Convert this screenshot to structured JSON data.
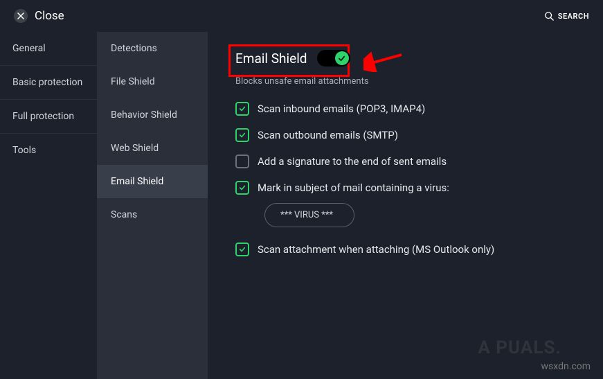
{
  "header": {
    "close_label": "Close",
    "search_label": "SEARCH"
  },
  "sidebar_primary": {
    "items": [
      {
        "label": "General"
      },
      {
        "label": "Basic protection"
      },
      {
        "label": "Full protection"
      },
      {
        "label": "Tools"
      }
    ]
  },
  "sidebar_secondary": {
    "items": [
      {
        "label": "Detections"
      },
      {
        "label": "File Shield"
      },
      {
        "label": "Behavior Shield"
      },
      {
        "label": "Web Shield"
      },
      {
        "label": "Email Shield",
        "active": true
      },
      {
        "label": "Scans"
      }
    ]
  },
  "main": {
    "title": "Email Shield",
    "toggle_on": true,
    "description": "Blocks unsafe email attachments",
    "options": [
      {
        "checked": true,
        "label": "Scan inbound emails (POP3, IMAP4)"
      },
      {
        "checked": true,
        "label": "Scan outbound emails (SMTP)"
      },
      {
        "checked": false,
        "label": "Add a signature to the end of sent emails"
      },
      {
        "checked": true,
        "label": "Mark in subject of mail containing a virus:"
      },
      {
        "checked": true,
        "label": "Scan attachment when attaching (MS Outlook only)"
      }
    ],
    "virus_subject_value": "*** VIRUS ***"
  },
  "watermark": "wsxdn.com",
  "logo_text": "A  PUALS."
}
